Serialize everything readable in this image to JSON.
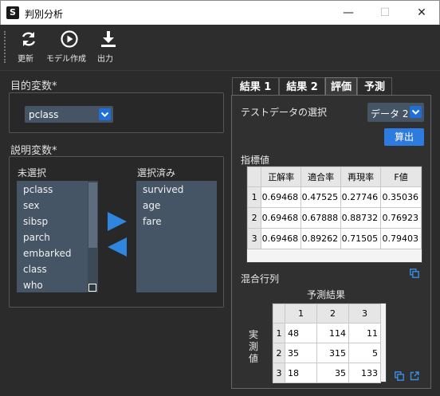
{
  "window": {
    "title": "判別分析",
    "app_icon": "S",
    "min_symbol": "—",
    "max_symbol": "☐",
    "close_symbol": "✕"
  },
  "toolbar": {
    "refresh_label": "更新",
    "model_label": "モデル作成",
    "output_label": "出力"
  },
  "target": {
    "section_title": "目的変数*",
    "selected": "pclass"
  },
  "explanatory": {
    "section_title": "説明変数*",
    "unselected_label": "未選択",
    "selected_label": "選択済み",
    "unselected_items": [
      "pclass",
      "sex",
      "sibsp",
      "parch",
      "embarked",
      "class",
      "who"
    ],
    "selected_items": [
      "survived",
      "age",
      "fare"
    ]
  },
  "tabs": [
    {
      "label": "結果 1",
      "active": false
    },
    {
      "label": "結果 2",
      "active": false
    },
    {
      "label": "評価",
      "active": true
    },
    {
      "label": "予測",
      "active": false
    }
  ],
  "evaluation": {
    "test_data_label": "テストデータの選択",
    "test_data_value": "データ 2",
    "calc_button": "算出",
    "metrics_title": "指標値",
    "metrics_headers": [
      "正解率",
      "適合率",
      "再現率",
      "F値"
    ],
    "metrics_rows": [
      {
        "index": "1",
        "values": [
          "0.69468",
          "0.47525",
          "0.27746",
          "0.35036"
        ]
      },
      {
        "index": "2",
        "values": [
          "0.69468",
          "0.67888",
          "0.88732",
          "0.76923"
        ]
      },
      {
        "index": "3",
        "values": [
          "0.69468",
          "0.89262",
          "0.71505",
          "0.79403"
        ]
      }
    ],
    "confusion_title": "混合行列",
    "predicted_label": "予測結果",
    "actual_label": "実測値",
    "confusion_headers": [
      "1",
      "2",
      "3"
    ],
    "confusion_rows": [
      {
        "index": "1",
        "values": [
          "48",
          "114",
          "11"
        ]
      },
      {
        "index": "2",
        "values": [
          "35",
          "315",
          "5"
        ]
      },
      {
        "index": "3",
        "values": [
          "18",
          "35",
          "133"
        ]
      }
    ]
  },
  "colors": {
    "accent": "#2e7be0",
    "list_bg": "#455565",
    "window_bg": "#2b2b2b"
  }
}
